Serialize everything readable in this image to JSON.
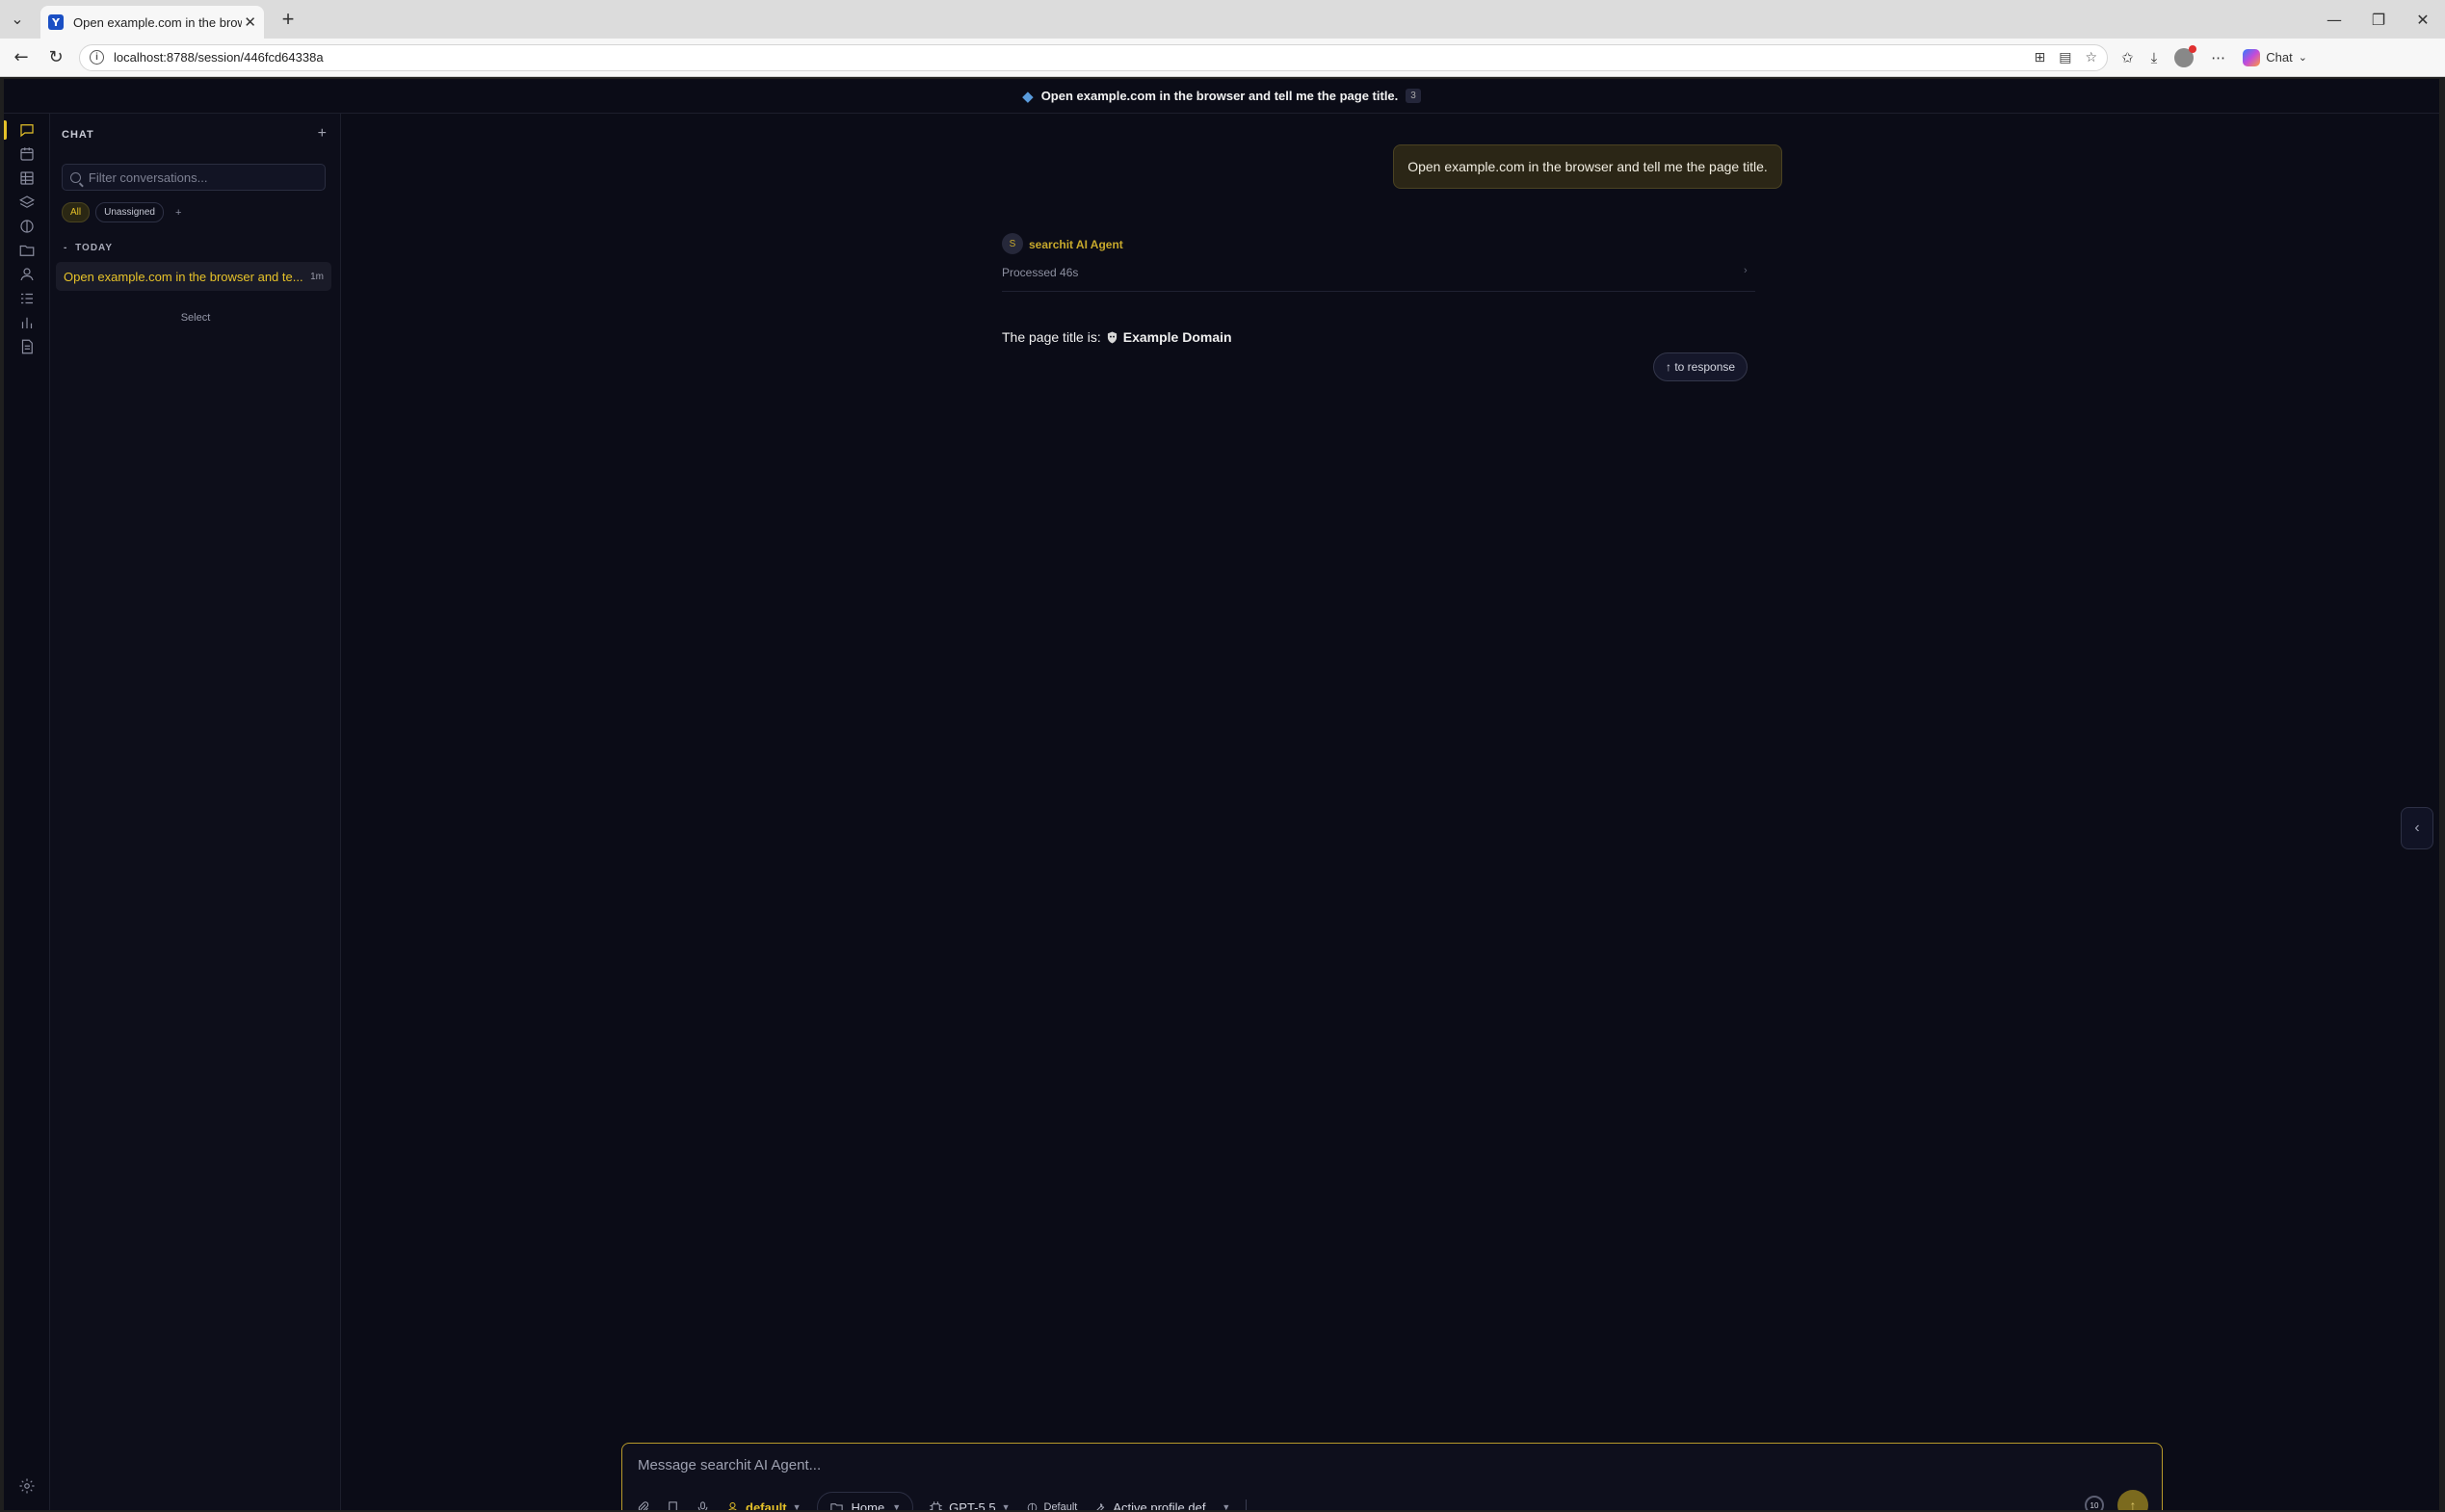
{
  "browser": {
    "tab_title": "Open example.com in the browser and tell me the page title.",
    "favicon_letter": "Y",
    "url": "localhost:8788/session/446fcd64338a",
    "copilot_label": "Chat"
  },
  "header": {
    "title": "Open example.com in the browser and tell me the page title.",
    "badge": "3"
  },
  "sidebar": {
    "title": "CHAT",
    "add_label": "+",
    "search_placeholder": "Filter conversations...",
    "filters": [
      "All",
      "Unassigned"
    ],
    "filter_add": "+",
    "group_label": "TODAY",
    "group_chevron": "-",
    "conversation": {
      "title": "Open example.com in the browser and te...",
      "time": "1m"
    },
    "select_label": "Select"
  },
  "chat": {
    "user_message": "Open example.com in the browser and tell me the page title.",
    "agent_initial": "S",
    "agent_name": "searchit AI Agent",
    "processed": "Processed 46s",
    "answer_prefix": "The page title is:",
    "answer_value": "Example Domain",
    "to_response": "↑ to response"
  },
  "composer": {
    "placeholder": "Message searchit AI Agent...",
    "profile": "default",
    "folder": "Home",
    "model": "GPT-5.5",
    "mode": "Default",
    "tools": "Active profile def...",
    "counter": "10"
  },
  "colors": {
    "accent": "#e6c229",
    "background": "#0b0c17",
    "bubble": "#2b2616"
  }
}
